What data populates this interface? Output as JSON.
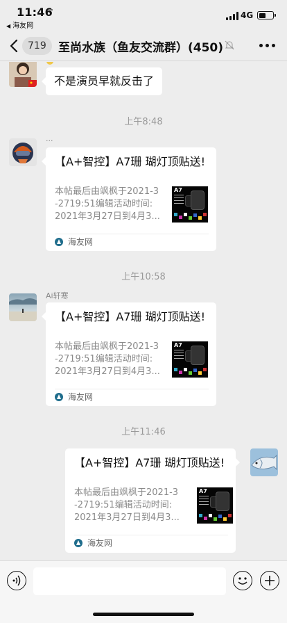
{
  "status_bar": {
    "time": "11:46",
    "location_arrow": "➶",
    "back_app": "海友网",
    "network": "4G",
    "battery_level": 0.4
  },
  "nav": {
    "unread_count": "719",
    "title": "至尚水族（鱼友交流群）(450)",
    "back_icon": "chevron-left-icon",
    "mute_icon": "bell-off-icon",
    "more_icon": "more-dots-icon"
  },
  "messages": {
    "m1": {
      "text": "不是演员早就反击了"
    },
    "t1": "上午8:48",
    "m2": {
      "nick": "...",
      "title": "【A+智控】A7珊 瑚灯顶贴送!",
      "desc": "本帖最后由飒枫于2021-3\n-2719:51编辑活动时间:\n2021年3月27日到4月3...",
      "source": "海友网",
      "thumb_text": "A7"
    },
    "t2": "上午10:58",
    "m3": {
      "nick": "Ai轩寒",
      "title": "【A+智控】A7珊 瑚灯顶贴送!",
      "desc": "本帖最后由飒枫于2021-3\n-2719:51编辑活动时间:\n2021年3月27日到4月3...",
      "source": "海友网",
      "thumb_text": "A7"
    },
    "t3": "上午11:46",
    "m4": {
      "title": "【A+智控】A7珊 瑚灯顶贴送!",
      "desc": "本帖最后由飒枫于2021-3\n-2719:51编辑活动时间:\n2021年3月27日到4月3...",
      "source": "海友网",
      "thumb_text": "A7"
    }
  },
  "input_bar": {
    "voice_icon": "voice-icon",
    "emoji_icon": "emoji-icon",
    "plus_icon": "plus-icon"
  },
  "colors": {
    "chat_bg": "#ededed",
    "bubble": "#ffffff",
    "meta_text": "#999999"
  }
}
